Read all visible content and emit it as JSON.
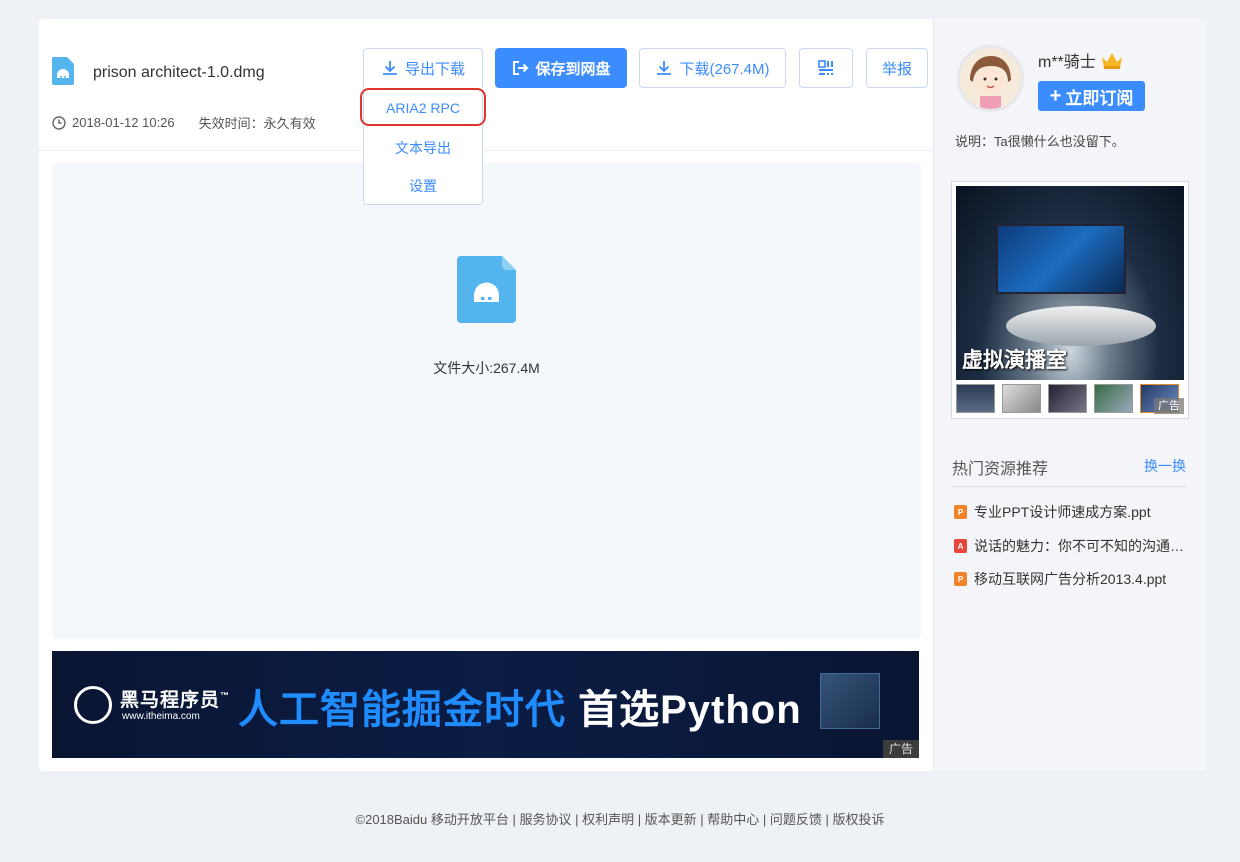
{
  "file": {
    "name": "prison architect-1.0.dmg",
    "date": "2018-01-12 10:26",
    "expiry": "失效时间：永久有效",
    "size_text": "文件大小:267.4M"
  },
  "toolbar": {
    "export_label": "导出下载",
    "save_label": "保存到网盘",
    "download_label": "下载(267.4M)",
    "report_label": "举报"
  },
  "export_menu": {
    "items": [
      "ARIA2 RPC",
      "文本导出",
      "设置"
    ],
    "highlighted": "ARIA2 RPC"
  },
  "banner": {
    "brand": "黑马程序员",
    "brand_tm": "™",
    "url": "www.itheima.com",
    "slogan_blue": "人工智能掘金时代",
    "slogan_white": " 首选Python",
    "ad_tag": "广告"
  },
  "user": {
    "name": "m**骑士",
    "subscribe_label": "立即订阅",
    "description": "说明：Ta很懒什么也没留下。"
  },
  "side_ad": {
    "title": "虚拟演播室",
    "ad_tag": "广告"
  },
  "hot": {
    "title": "热门资源推荐",
    "refresh_label": "换一换",
    "items": [
      {
        "label": "专业PPT设计师速成方案.ppt",
        "type": "ppt",
        "color": "#f0832a",
        "glyph": "P"
      },
      {
        "label": "说话的魅力：你不可不知的沟通…",
        "type": "pdf",
        "color": "#e8453c",
        "glyph": "A"
      },
      {
        "label": "移动互联网广告分析2013.4.ppt",
        "type": "ppt",
        "color": "#f0832a",
        "glyph": "P"
      }
    ]
  },
  "footer": {
    "text": "©2018Baidu 移动开放平台 | 服务协议 | 权利声明 | 版本更新 | 帮助中心 | 问题反馈 | 版权投诉"
  },
  "colors": {
    "accent": "#3b8cff",
    "highlight_ring": "#e0352b",
    "page_bg": "#eef1f5"
  }
}
